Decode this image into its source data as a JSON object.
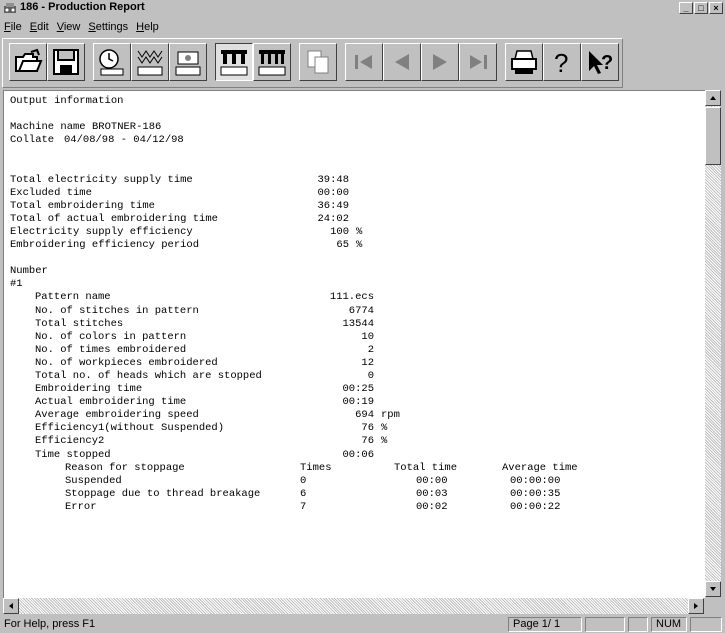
{
  "window": {
    "title": "186 - Production Report"
  },
  "menu": [
    {
      "u": "F",
      "rest": "ile"
    },
    {
      "u": "E",
      "rest": "dit"
    },
    {
      "u": "V",
      "rest": "iew"
    },
    {
      "u": "S",
      "rest": "ettings"
    },
    {
      "u": "H",
      "rest": "elp"
    }
  ],
  "toolbar": {
    "buttons": [
      {
        "name": "open-folder-icon"
      },
      {
        "name": "save-disk-icon"
      },
      {
        "name": "clock-icon"
      },
      {
        "name": "stitch-pattern-icon"
      },
      {
        "name": "machine-icon"
      },
      {
        "name": "multi-head-machine-icon"
      },
      {
        "name": "multi-head-machine-alt-icon"
      },
      {
        "name": "copy-icon"
      },
      {
        "name": "first-page-icon"
      },
      {
        "name": "previous-page-icon"
      },
      {
        "name": "next-page-icon"
      },
      {
        "name": "last-page-icon"
      },
      {
        "name": "print-icon"
      },
      {
        "name": "help-icon"
      },
      {
        "name": "context-help-icon"
      }
    ]
  },
  "report": {
    "header": "Output information",
    "machine_label": "Machine name",
    "machine_value": "BROTNER-186",
    "collate_label": "Collate",
    "collate_value": "04/08/98 - 04/12/98",
    "summary": [
      {
        "label": "Total electricity supply time",
        "value": "39:48",
        "unit": ""
      },
      {
        "label": "Excluded time",
        "value": "00:00",
        "unit": ""
      },
      {
        "label": "Total embroidering time",
        "value": "36:49",
        "unit": ""
      },
      {
        "label": "Total of actual embroidering time",
        "value": "24:02",
        "unit": ""
      },
      {
        "label": "Electricity supply efficiency",
        "value": "100",
        "unit": "%"
      },
      {
        "label": "Embroidering efficiency period",
        "value": "65",
        "unit": "%"
      }
    ],
    "number_label": "Number",
    "number_value": "#1",
    "details": [
      {
        "label": "Pattern name",
        "value": "111.ecs",
        "unit": ""
      },
      {
        "label": "No. of stitches in pattern",
        "value": "6774",
        "unit": ""
      },
      {
        "label": "Total stitches",
        "value": "13544",
        "unit": ""
      },
      {
        "label": "No. of colors in pattern",
        "value": "10",
        "unit": ""
      },
      {
        "label": "No. of times embroidered",
        "value": "2",
        "unit": ""
      },
      {
        "label": "No. of workpieces embroidered",
        "value": "12",
        "unit": ""
      },
      {
        "label": "Total no. of heads which are stopped",
        "value": "0",
        "unit": ""
      },
      {
        "label": "Embroidering time",
        "value": "00:25",
        "unit": ""
      },
      {
        "label": "Actual embroidering time",
        "value": "00:19",
        "unit": ""
      },
      {
        "label": "Average embroidering speed",
        "value": "694",
        "unit": "rpm"
      },
      {
        "label": "Efficiency1(without Suspended)",
        "value": "76",
        "unit": "%"
      },
      {
        "label": "Efficiency2",
        "value": "76",
        "unit": "%"
      },
      {
        "label": "Time stopped",
        "value": "00:06",
        "unit": ""
      }
    ],
    "stoppage_headers": {
      "reason": "Reason for stoppage",
      "times": "Times",
      "total": "Total time",
      "average": "Average time"
    },
    "stoppages": [
      {
        "reason": "Suspended",
        "times": "0",
        "total": "00:00",
        "average": "00:00:00"
      },
      {
        "reason": "Stoppage due to thread breakage",
        "times": "6",
        "total": "00:03",
        "average": "00:00:35"
      },
      {
        "reason": "Error",
        "times": "7",
        "total": "00:02",
        "average": "00:00:22"
      }
    ]
  },
  "status": {
    "help": "For Help, press F1",
    "page": "Page  1/ 1",
    "num": "NUM"
  }
}
